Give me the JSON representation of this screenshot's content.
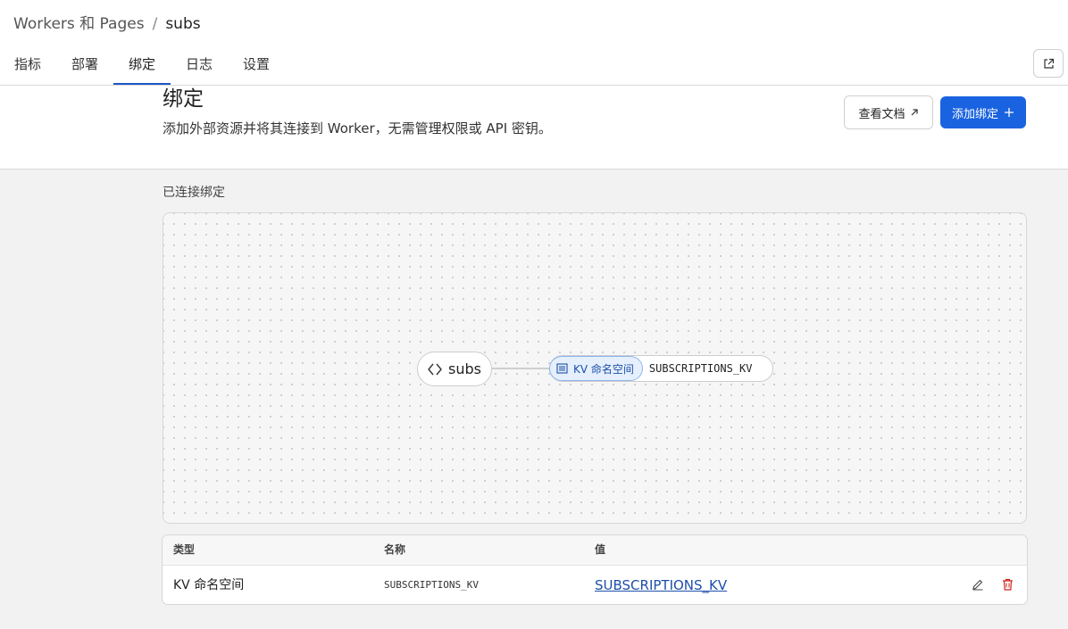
{
  "breadcrumb": {
    "root": "Workers 和 Pages",
    "separator": "/",
    "current": "subs"
  },
  "tabs": [
    {
      "label": "指标",
      "active": false
    },
    {
      "label": "部署",
      "active": false
    },
    {
      "label": "绑定",
      "active": true
    },
    {
      "label": "日志",
      "active": false
    },
    {
      "label": "设置",
      "active": false
    }
  ],
  "header": {
    "title": "绑定",
    "description": "添加外部资源并将其连接到 Worker，无需管理权限或 API 密钥。",
    "docs_button": "查看文档",
    "add_button": "添加绑定"
  },
  "connected": {
    "label": "已连接绑定",
    "worker_node": "subs",
    "binding_type": "KV 命名空间",
    "binding_name": "SUBSCRIPTIONS_KV"
  },
  "table": {
    "headers": {
      "type": "类型",
      "name": "名称",
      "value": "值"
    },
    "rows": [
      {
        "type": "KV 命名空间",
        "name": "SUBSCRIPTIONS_KV",
        "value": "SUBSCRIPTIONS_KV"
      }
    ]
  },
  "colors": {
    "accent": "#1a63e0",
    "link": "#1d4fa8",
    "delete": "#d0201c",
    "pill_bg": "#e6f0fd"
  },
  "icons": {
    "external": "external-link-icon",
    "docs_arrow": "arrow-up-right-icon",
    "add": "plus-icon",
    "worker": "code-brackets-icon",
    "kv": "kv-namespace-icon",
    "edit": "pencil-icon",
    "delete": "trash-icon"
  }
}
